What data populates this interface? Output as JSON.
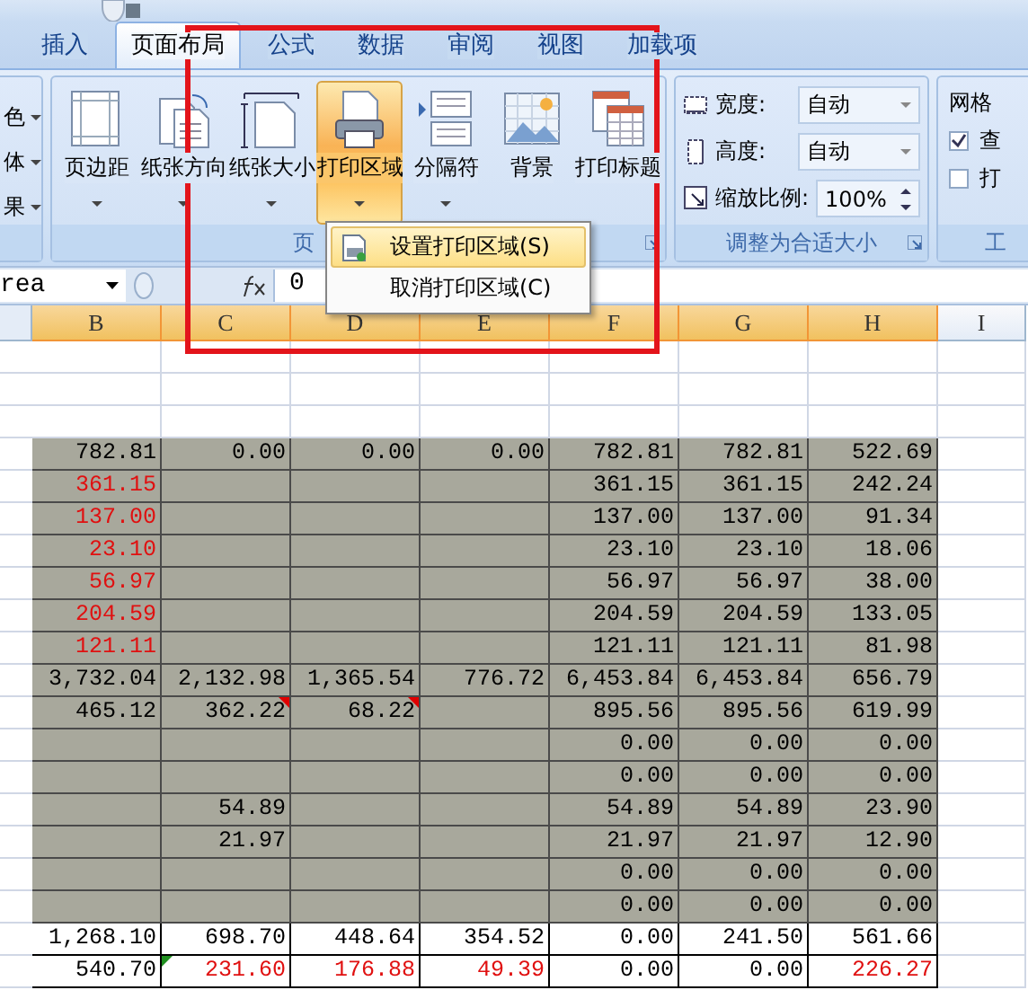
{
  "tabs": [
    {
      "label": "插入",
      "selected": false
    },
    {
      "label": "页面布局",
      "selected": true
    },
    {
      "label": "公式",
      "selected": false
    },
    {
      "label": "数据",
      "selected": false
    },
    {
      "label": "审阅",
      "selected": false
    },
    {
      "label": "视图",
      "selected": false
    },
    {
      "label": "加载项",
      "selected": false
    }
  ],
  "ribbon": {
    "themes_group": {
      "items": [
        "色",
        "体",
        "果"
      ]
    },
    "page_setup_group": {
      "label": "页",
      "buttons": [
        {
          "kind": "margins",
          "label": "页边距",
          "active": false,
          "dropdown": true
        },
        {
          "kind": "orientation",
          "label": "纸张方向",
          "active": false,
          "dropdown": true
        },
        {
          "kind": "size",
          "label": "纸张大小",
          "active": false,
          "dropdown": true
        },
        {
          "kind": "print-area",
          "label": "打印区域",
          "active": true,
          "dropdown": true
        },
        {
          "kind": "breaks",
          "label": "分隔符",
          "active": false,
          "dropdown": true
        },
        {
          "kind": "background",
          "label": "背景",
          "active": false,
          "dropdown": false
        },
        {
          "kind": "print-titles",
          "label": "打印标题",
          "active": false,
          "dropdown": false
        }
      ]
    },
    "scale_group": {
      "label": "调整为合适大小",
      "fields": [
        {
          "kind": "dropdown",
          "label": "宽度:",
          "value": "自动"
        },
        {
          "kind": "dropdown",
          "label": "高度:",
          "value": "自动"
        },
        {
          "kind": "spinner",
          "label": "缩放比例:",
          "value": "100%"
        }
      ]
    },
    "sheet_options_group": {
      "title": "网格",
      "options": [
        {
          "label": "查",
          "checked": true
        },
        {
          "label": "打",
          "checked": false
        }
      ],
      "label": "工"
    }
  },
  "formula_bar": {
    "name_box": "rea",
    "formula": "0"
  },
  "columns": [
    {
      "label": "B",
      "selected": true
    },
    {
      "label": "C",
      "selected": true
    },
    {
      "label": "D",
      "selected": true
    },
    {
      "label": "E",
      "selected": true
    },
    {
      "label": "F",
      "selected": true
    },
    {
      "label": "G",
      "selected": true
    },
    {
      "label": "H",
      "selected": true
    },
    {
      "label": "I",
      "selected": false
    }
  ],
  "sheet": {
    "rows": [
      {
        "print_area": false,
        "cells": [
          null,
          null,
          null,
          null,
          null,
          null,
          null
        ]
      },
      {
        "print_area": false,
        "cells": [
          null,
          null,
          null,
          null,
          null,
          null,
          null
        ]
      },
      {
        "print_area": false,
        "cells": [
          null,
          null,
          null,
          null,
          null,
          null,
          null
        ]
      },
      {
        "print_area": true,
        "cells": [
          "782.81",
          "0.00",
          "0.00",
          "0.00",
          "782.81",
          "782.81",
          "522.69"
        ]
      },
      {
        "print_area": true,
        "cells": [
          {
            "text": "361.15",
            "red": true
          },
          null,
          null,
          null,
          "361.15",
          "361.15",
          "242.24"
        ]
      },
      {
        "print_area": true,
        "cells": [
          {
            "text": "137.00",
            "red": true
          },
          null,
          null,
          null,
          "137.00",
          "137.00",
          "91.34"
        ]
      },
      {
        "print_area": true,
        "cells": [
          {
            "text": "23.10",
            "red": true
          },
          null,
          null,
          null,
          "23.10",
          "23.10",
          "18.06"
        ]
      },
      {
        "print_area": true,
        "cells": [
          {
            "text": "56.97",
            "red": true
          },
          null,
          null,
          null,
          "56.97",
          "56.97",
          "38.00"
        ]
      },
      {
        "print_area": true,
        "cells": [
          {
            "text": "204.59",
            "red": true
          },
          null,
          null,
          null,
          "204.59",
          "204.59",
          "133.05"
        ]
      },
      {
        "print_area": true,
        "cells": [
          {
            "text": "121.11",
            "red": true
          },
          null,
          null,
          null,
          "121.11",
          "121.11",
          "81.98"
        ]
      },
      {
        "print_area": true,
        "cells": [
          "3,732.04",
          "2,132.98",
          "1,365.54",
          "776.72",
          "6,453.84",
          "6,453.84",
          "656.79"
        ]
      },
      {
        "print_area": true,
        "cells": [
          "465.12",
          {
            "text": "362.22",
            "comment": true
          },
          {
            "text": "68.22",
            "comment": true
          },
          null,
          "895.56",
          "895.56",
          "619.99"
        ]
      },
      {
        "print_area": true,
        "cells": [
          null,
          null,
          null,
          null,
          "0.00",
          "0.00",
          "0.00"
        ]
      },
      {
        "print_area": true,
        "cells": [
          null,
          null,
          null,
          null,
          "0.00",
          "0.00",
          "0.00"
        ]
      },
      {
        "print_area": true,
        "cells": [
          null,
          "54.89",
          null,
          null,
          "54.89",
          "54.89",
          "23.90"
        ]
      },
      {
        "print_area": true,
        "cells": [
          null,
          "21.97",
          null,
          null,
          "21.97",
          "21.97",
          "12.90"
        ]
      },
      {
        "print_area": true,
        "cells": [
          null,
          null,
          null,
          null,
          "0.00",
          "0.00",
          "0.00"
        ]
      },
      {
        "print_area": true,
        "cells": [
          null,
          null,
          null,
          null,
          "0.00",
          "0.00",
          "0.00"
        ]
      },
      {
        "print_area": false,
        "cells": [
          "1,268.10",
          "698.70",
          "448.64",
          "354.52",
          "0.00",
          "241.50",
          "561.66"
        ]
      },
      {
        "print_area": false,
        "cells": [
          "540.70",
          {
            "text": "231.60",
            "red": true,
            "error_flag": true
          },
          {
            "text": "176.88",
            "red": true
          },
          {
            "text": "49.39",
            "red": true
          },
          "0.00",
          "0.00",
          {
            "text": "226.27",
            "red": true
          }
        ]
      }
    ]
  },
  "print_area_menu": {
    "items": [
      {
        "label": "设置打印区域(S)",
        "selected": true
      },
      {
        "label": "取消打印区域(C)",
        "selected": false
      }
    ]
  }
}
